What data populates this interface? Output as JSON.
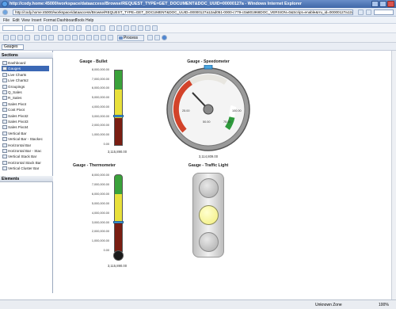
{
  "window": {
    "title": "http://cody.home:45000/workspace/dataaccess/Browse/REQUEST_TYPE=GET_DOCUMENT&DOC_UUID=00000127a - Windows Internet Explorer",
    "url": "http://cody.home:45000/workspace/dataaccess/Browse/REQUEST_TYPE=GET_DOCUMENT&DOC_UUID=00000127a12ad051-0000-c779-c0a801968DOC_VERSION=0&Script=enable&rru_id=00000127a12ad051-0000-c779-c0a801968%3Adocumentillesp"
  },
  "menu": [
    "File",
    "Edit",
    "View",
    "Insert",
    "Format",
    "Dashboard",
    "Tools",
    "Help"
  ],
  "toolbar": {
    "process_label": "Process",
    "gauges_dropdown": "Gauges"
  },
  "sidebar": {
    "sections_title": "Sections",
    "items": [
      "Dashboard",
      "Gauges",
      "Live Charts",
      "Live Charts2",
      "Groupings",
      "Q_Sales",
      "R_Sales",
      "Sales Pivot",
      "Cost Pivot",
      "Sales Pivot2",
      "Sales Pivot3",
      "Sales Pivot4",
      "Vertical Bar",
      "Vertical Bar - Stackec",
      "Horizontal Bar",
      "Horizontal Bar - Stac",
      "Vertical Stack Bar",
      "Horizontal Stack Bar",
      "Vertical Cluster Bar"
    ],
    "elements_title": "Elements"
  },
  "gauges": {
    "bullet": {
      "title": "Gauge - Bullet",
      "ticks": [
        "8,000,000.00",
        "7,000,000.00",
        "6,000,000.00",
        "5,000,000.00",
        "4,000,000.00",
        "3,000,000.00",
        "2,000,000.00",
        "1,000,000.00",
        "0.00"
      ],
      "value": "3,115,890.00",
      "level": 0.39
    },
    "speedometer": {
      "title": "Gauge - Speedometer",
      "ticks": [
        "25.00",
        "50.00",
        "75.00",
        "100.00"
      ],
      "value": "3,114,809.00",
      "needle": 0.3
    },
    "thermometer": {
      "title": "Gauge - Thermometer",
      "ticks": [
        "8,000,000.00",
        "7,000,000.00",
        "6,000,000.00",
        "5,000,000.00",
        "4,000,000.00",
        "3,000,000.00",
        "2,000,000.00",
        "1,000,000.00",
        "0.00"
      ],
      "value": "3,115,890.00",
      "level": 0.39
    },
    "traffic": {
      "title": "Gauge - Traffic Light",
      "active": "yellow"
    }
  },
  "status": {
    "zone": "Unknown Zone",
    "zoom": "100%"
  }
}
